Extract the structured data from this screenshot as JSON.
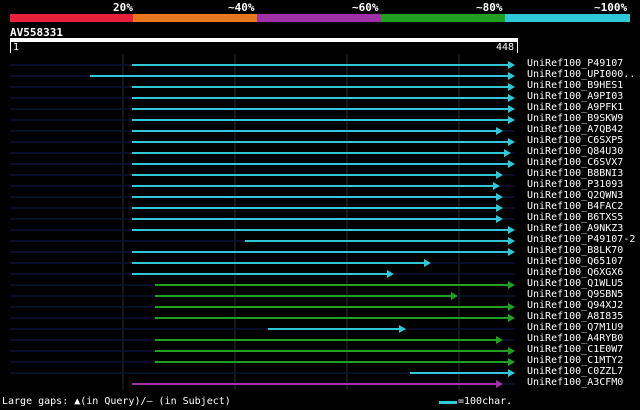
{
  "legend": [
    {
      "label": "20%",
      "color": "#e8203c"
    },
    {
      "label": "~40%",
      "color": "#e87820"
    },
    {
      "label": "~60%",
      "color": "#a030a8"
    },
    {
      "label": "~80%",
      "color": "#20a020"
    },
    {
      "label": "~100%",
      "color": "#30c8d8"
    }
  ],
  "query": {
    "name": "AV558331",
    "start": "1",
    "end": "448",
    "length": 448
  },
  "hits": [
    {
      "name": "UniRef100_P49107",
      "start": 152,
      "end": 587,
      "color": "#30c8d8",
      "line_start": 0
    },
    {
      "name": "UniRef100_UPI000..",
      "start": 110,
      "end": 587,
      "color": "#30c8d8",
      "line_start": 0
    },
    {
      "name": "UniRef100_B9HES1",
      "start": 152,
      "end": 587,
      "color": "#30c8d8",
      "line_start": 0
    },
    {
      "name": "UniRef100_A9PI03",
      "start": 152,
      "end": 587,
      "color": "#30c8d8",
      "line_start": 0
    },
    {
      "name": "UniRef100_A9PFK1",
      "start": 152,
      "end": 587,
      "color": "#30c8d8",
      "line_start": 0
    },
    {
      "name": "UniRef100_B9SKW9",
      "start": 152,
      "end": 587,
      "color": "#30c8d8",
      "line_start": 0
    },
    {
      "name": "UniRef100_A7QB42",
      "start": 152,
      "end": 575,
      "color": "#30c8d8",
      "line_start": 0
    },
    {
      "name": "UniRef100_C6SXP5",
      "start": 152,
      "end": 587,
      "color": "#30c8d8",
      "line_start": 0
    },
    {
      "name": "UniRef100_Q84U30",
      "start": 152,
      "end": 583,
      "color": "#30c8d8",
      "line_start": 0
    },
    {
      "name": "UniRef100_C6SVX7",
      "start": 152,
      "end": 587,
      "color": "#30c8d8",
      "line_start": 0
    },
    {
      "name": "UniRef100_B8BNI3",
      "start": 152,
      "end": 575,
      "color": "#30c8d8",
      "line_start": 0
    },
    {
      "name": "UniRef100_P31093",
      "start": 152,
      "end": 572,
      "color": "#30c8d8",
      "line_start": 0
    },
    {
      "name": "UniRef100_Q2QWN3",
      "start": 152,
      "end": 575,
      "color": "#30c8d8",
      "line_start": 0
    },
    {
      "name": "UniRef100_B4FAC2",
      "start": 152,
      "end": 575,
      "color": "#30c8d8",
      "line_start": 0
    },
    {
      "name": "UniRef100_B6TXS5",
      "start": 152,
      "end": 575,
      "color": "#30c8d8",
      "line_start": 0
    },
    {
      "name": "UniRef100_A9NKZ3",
      "start": 152,
      "end": 587,
      "color": "#30c8d8",
      "line_start": 0
    },
    {
      "name": "UniRef100_P49107-2",
      "start": 265,
      "end": 587,
      "color": "#30c8d8",
      "line_start": 0
    },
    {
      "name": "UniRef100_B8LK70",
      "start": 152,
      "end": 587,
      "color": "#30c8d8",
      "line_start": 0
    },
    {
      "name": "UniRef100_Q65107",
      "start": 152,
      "end": 503,
      "color": "#30c8d8",
      "line_start": 0
    },
    {
      "name": "UniRef100_Q6XGX6",
      "start": 152,
      "end": 466,
      "color": "#30c8d8",
      "line_start": 0
    },
    {
      "name": "UniRef100_Q1WLU5",
      "start": 175,
      "end": 587,
      "color": "#20a020",
      "line_start": 0
    },
    {
      "name": "UniRef100_Q9SBN5",
      "start": 175,
      "end": 530,
      "color": "#20a020",
      "line_start": 0
    },
    {
      "name": "UniRef100_Q94XJ2",
      "start": 175,
      "end": 587,
      "color": "#20a020",
      "line_start": 0
    },
    {
      "name": "UniRef100_A8I835",
      "start": 175,
      "end": 587,
      "color": "#20a020",
      "line_start": 0
    },
    {
      "name": "UniRef100_Q7M1U9",
      "start": 288,
      "end": 478,
      "color": "#30c8d8",
      "line_start": 0
    },
    {
      "name": "UniRef100_A4RYB0",
      "start": 175,
      "end": 575,
      "color": "#20a020",
      "line_start": 0
    },
    {
      "name": "UniRef100_C1E0W7",
      "start": 175,
      "end": 587,
      "color": "#20a020",
      "line_start": 0
    },
    {
      "name": "UniRef100_C1MTY2",
      "start": 175,
      "end": 587,
      "color": "#20a020",
      "line_start": 0
    },
    {
      "name": "UniRef100_C0ZZL7",
      "start": 430,
      "end": 587,
      "color": "#30c8d8",
      "line_start": 0
    },
    {
      "name": "UniRef100_A3CFM0",
      "start": 152,
      "end": 575,
      "color": "#a030a8",
      "line_start": 150
    }
  ],
  "footer": {
    "gaps_text": "Large gaps: ▲(in Query)/– (in Subject)",
    "scale_text": "=100char."
  }
}
